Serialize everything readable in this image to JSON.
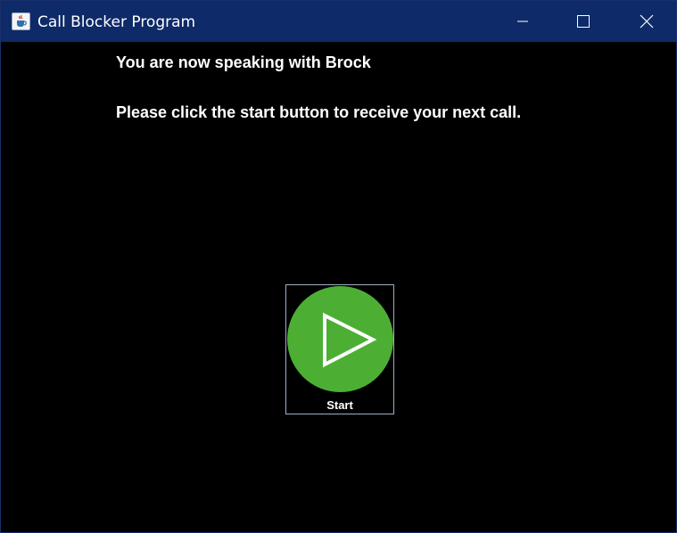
{
  "window": {
    "title": "Call Blocker Program",
    "controls": [
      "minimize",
      "maximize",
      "close"
    ]
  },
  "content": {
    "speaking_text": "You are now speaking with Brock",
    "instruction_text": "Please click the start button to receive your next call.",
    "start_label": "Start"
  },
  "icons": {
    "app": "java-cup-icon",
    "start": "play-icon"
  },
  "colors": {
    "titlebar": "#0e2a68",
    "background": "#000000",
    "start_circle": "#4caf34",
    "text": "#ffffff"
  }
}
